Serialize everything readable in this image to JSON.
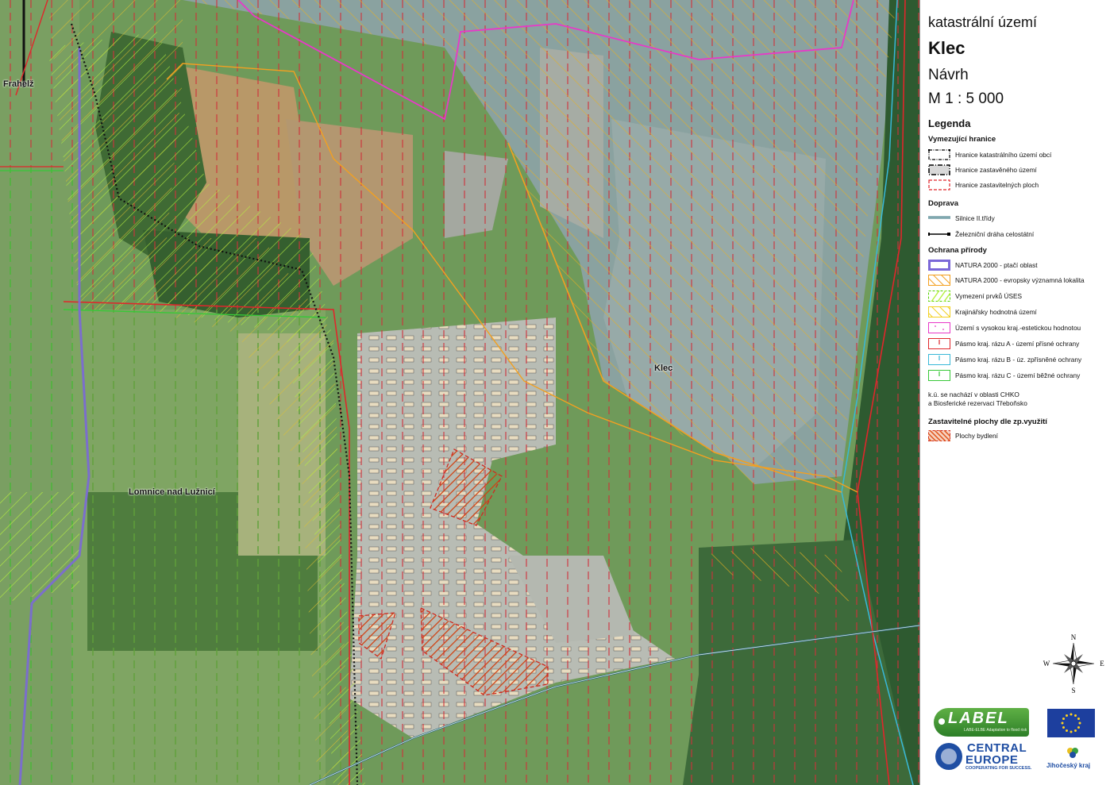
{
  "header": {
    "area_label": "katastrální území",
    "name": "Klec",
    "status": "Návrh",
    "scale": "M 1 : 5 000",
    "legend_title": "Legenda"
  },
  "legend": {
    "boundaries": {
      "title": "Vymezující hranice",
      "items": [
        {
          "label": "Hranice katastrálního území obcí",
          "color": "#000000"
        },
        {
          "label": "Hranice zastavěného území",
          "color": "#000000"
        },
        {
          "label": "Hranice zastavitelných ploch",
          "color": "#e0262b"
        }
      ]
    },
    "transport": {
      "title": "Doprava",
      "items": [
        {
          "label": "Silnice II.třídy",
          "color": "#2f6b7a"
        },
        {
          "label": "Železniční dráha celostátní",
          "color": "#000000"
        }
      ]
    },
    "nature": {
      "title": "Ochrana přírody",
      "items": [
        {
          "label": "NATURA 2000 - ptačí oblast",
          "color": "#7b68d8"
        },
        {
          "label": "NATURA 2000 - evropsky významná lokalita",
          "color": "#f3a020"
        },
        {
          "label": "Vymezení prvků ÚSES",
          "color": "#55d000"
        },
        {
          "label": "Krajinářsky hodnotná území",
          "color": "#f2d020"
        },
        {
          "label": "Území s vysokou kraj.-estetickou hodnotou",
          "color": "#e838c8"
        },
        {
          "label": "Pásmo kraj. rázu A - území přísné ochrany",
          "color": "#e0262b"
        },
        {
          "label": "Pásmo kraj. rázu B - úz. zpřísněné ochrany",
          "color": "#38b8d8"
        },
        {
          "label": "Pásmo kraj. rázu C - území běžné ochrany",
          "color": "#38c838"
        }
      ]
    },
    "note": [
      "k.ú. se nachází v oblasti CHKO",
      "a Biosferické rezervaci Třeboňsko"
    ],
    "zoning": {
      "title": "Zastavitelné plochy dle zp.využití",
      "items": [
        {
          "label": "Plochy bydlení",
          "color": "#e0541a"
        }
      ]
    }
  },
  "map": {
    "labels": [
      {
        "text": "Frahelž"
      },
      {
        "text": "Lomnice nad Lužnicí"
      },
      {
        "text": "Klec"
      }
    ]
  },
  "compass": {
    "n": "N",
    "s": "S",
    "e": "E",
    "w": "W"
  },
  "logos": {
    "label": {
      "text": "LABEL",
      "tagline": "LABE-ELBE Adaptation to flood risk"
    },
    "central_europe": {
      "line1": "CENTRAL",
      "line2": "EUROPE",
      "tagline": "COOPERATING FOR SUCCESS."
    },
    "region": {
      "text": "Jihočeský kraj"
    }
  }
}
